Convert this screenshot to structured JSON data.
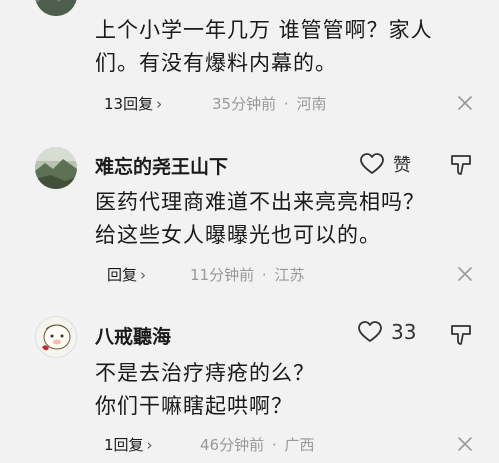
{
  "comments": [
    {
      "username": "",
      "like_label": "",
      "text_lines": [
        "上个小学一年几万 谁管管啊？家人",
        "们。有没有爆料内幕的。"
      ],
      "reply_label": "13回复",
      "time": "35分钟前",
      "location": "河南",
      "avatar_icon": "avatar-landscape-icon"
    },
    {
      "username": "难忘的尧王山下",
      "like_label": "赞",
      "text_lines": [
        "医药代理商难道不出来亮亮相吗？",
        "给这些女人曝曝光也可以的。"
      ],
      "reply_label": "回复",
      "time": "11分钟前",
      "location": "江苏",
      "avatar_icon": "avatar-landscape-icon"
    },
    {
      "username": "八戒聽海",
      "like_label": "33",
      "text_lines": [
        "不是去治疗痔疮的么？",
        "你们干嘛瞎起哄啊？"
      ],
      "reply_label": "1回复",
      "time": "46分钟前",
      "location": "广西",
      "avatar_icon": "avatar-cartoon-icon"
    }
  ],
  "separator": "·"
}
